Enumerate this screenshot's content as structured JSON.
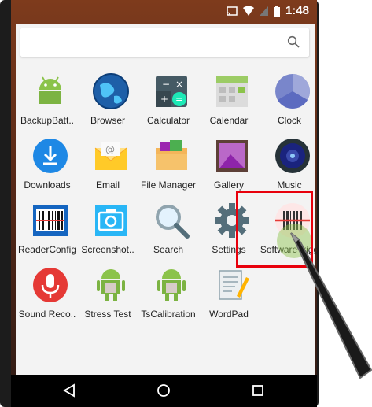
{
  "status": {
    "time": "1:48"
  },
  "search": {
    "icon": "search-icon"
  },
  "apps": [
    {
      "label": "BackupBatt..",
      "icon": "android-icon"
    },
    {
      "label": "Browser",
      "icon": "globe-icon"
    },
    {
      "label": "Calculator",
      "icon": "calculator-icon"
    },
    {
      "label": "Calendar",
      "icon": "calendar-icon"
    },
    {
      "label": "Clock",
      "icon": "clock-icon"
    },
    {
      "label": "Downloads",
      "icon": "download-icon"
    },
    {
      "label": "Email",
      "icon": "envelope-icon"
    },
    {
      "label": "File Manager",
      "icon": "folder-icon"
    },
    {
      "label": "Gallery",
      "icon": "picture-icon"
    },
    {
      "label": "Music",
      "icon": "speaker-icon"
    },
    {
      "label": "ReaderConfig",
      "icon": "barcode-icon"
    },
    {
      "label": "Screenshot..",
      "icon": "camera-icon"
    },
    {
      "label": "Search",
      "icon": "magnifier-icon"
    },
    {
      "label": "Settings",
      "icon": "gear-icon"
    },
    {
      "label": "SoftwareTrigg",
      "icon": "barcode-scan-icon"
    },
    {
      "label": "Sound Reco..",
      "icon": "microphone-icon"
    },
    {
      "label": "Stress Test",
      "icon": "android-box-icon"
    },
    {
      "label": "TsCalibration",
      "icon": "android-box-icon"
    },
    {
      "label": "WordPad",
      "icon": "notepad-icon"
    }
  ],
  "colors": {
    "highlight": "#e8000c",
    "accent": "#2196f3"
  }
}
